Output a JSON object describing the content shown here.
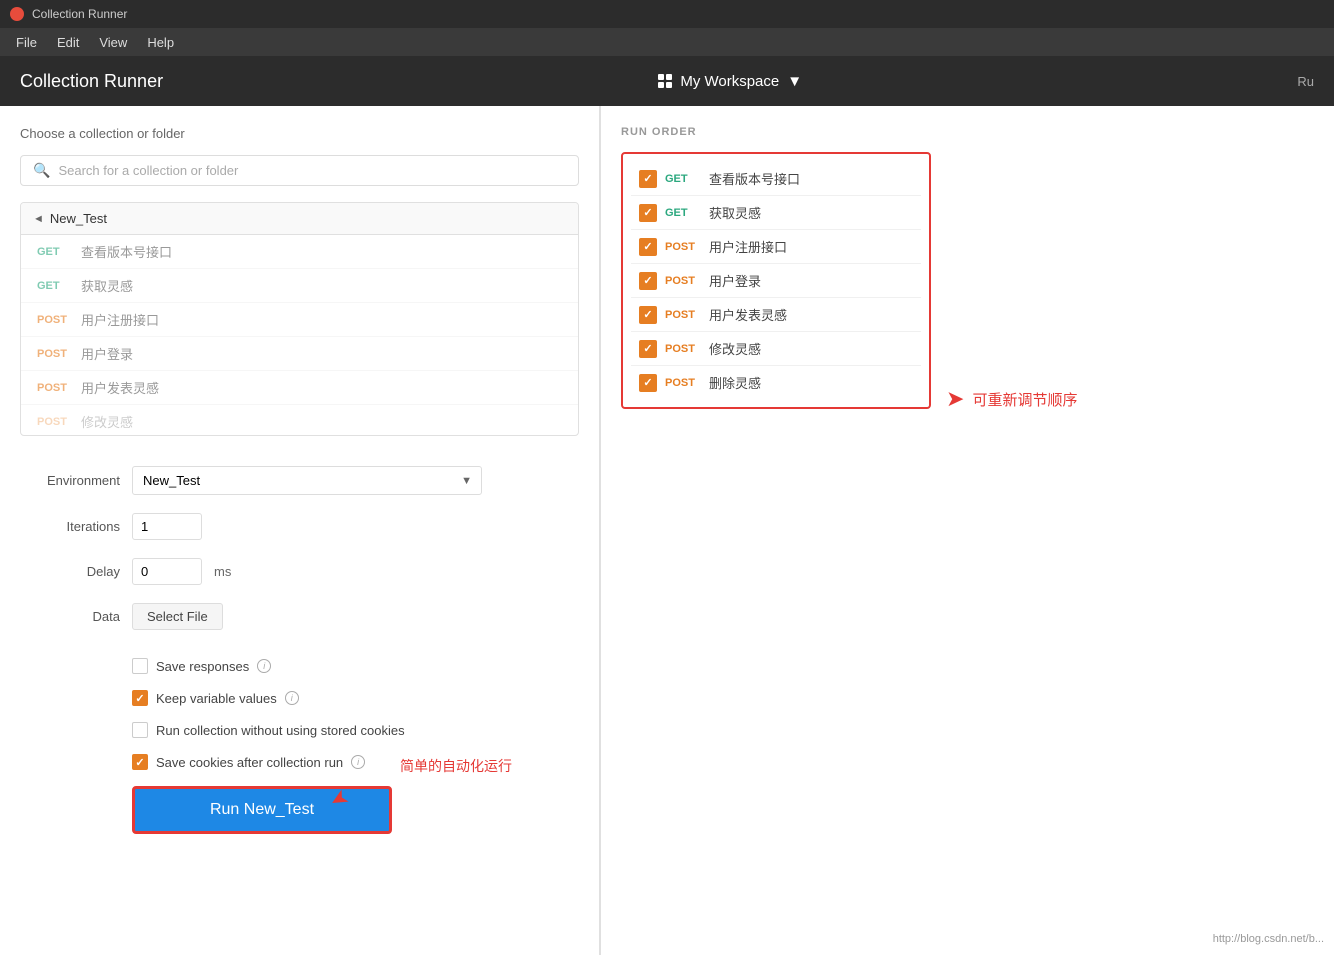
{
  "titleBar": {
    "appName": "Collection Runner"
  },
  "menuBar": {
    "items": [
      "File",
      "Edit",
      "View",
      "Help"
    ]
  },
  "header": {
    "title": "Collection Runner",
    "workspace": "My Workspace",
    "rightLabel": "Ru"
  },
  "leftPanel": {
    "subtitle": "Choose a collection or folder",
    "search": {
      "placeholder": "Search for a collection or folder"
    },
    "collection": {
      "name": "New_Test",
      "items": [
        {
          "method": "GET",
          "name": "查看版本号接口",
          "type": "get"
        },
        {
          "method": "GET",
          "name": "获取灵感",
          "type": "get"
        },
        {
          "method": "POST",
          "name": "用户注册接口",
          "type": "post"
        },
        {
          "method": "POST",
          "name": "用户登录",
          "type": "post"
        },
        {
          "method": "POST",
          "name": "用户发表灵感",
          "type": "post"
        },
        {
          "method": "POST",
          "name": "修改灵感",
          "type": "post",
          "partial": true
        }
      ]
    },
    "form": {
      "environmentLabel": "Environment",
      "environmentValue": "New_Test",
      "iterationsLabel": "Iterations",
      "iterationsValue": "1",
      "delayLabel": "Delay",
      "delayValue": "0",
      "delayUnit": "ms",
      "dataLabel": "Data",
      "selectFileLabel": "Select File",
      "checkboxes": [
        {
          "label": "Save responses",
          "checked": false,
          "hasInfo": true
        },
        {
          "label": "Keep variable values",
          "checked": true,
          "hasInfo": true
        },
        {
          "label": "Run collection without using stored cookies",
          "checked": false,
          "hasInfo": false
        }
      ],
      "saveCookiesLabel": "Save cookies after collection run",
      "saveCookiesChecked": true,
      "saveCookiesHasInfo": true,
      "runButtonLabel": "Run New_Test"
    }
  },
  "rightPanel": {
    "runOrderTitle": "RUN ORDER",
    "items": [
      {
        "method": "GET",
        "name": "查看版本号接口",
        "type": "get"
      },
      {
        "method": "GET",
        "name": "获取灵感",
        "type": "get"
      },
      {
        "method": "POST",
        "name": "用户注册接口",
        "type": "post"
      },
      {
        "method": "POST",
        "name": "用户登录",
        "type": "post"
      },
      {
        "method": "POST",
        "name": "用户发表灵感",
        "type": "post"
      },
      {
        "method": "POST",
        "name": "修改灵感",
        "type": "post"
      },
      {
        "method": "POST",
        "name": "删除灵感",
        "type": "post"
      }
    ],
    "annotation": "可重新调节顺序",
    "bottomAnnotation": "简单的自动化运行"
  },
  "watermark": "http://blog.csdn.net/b..."
}
